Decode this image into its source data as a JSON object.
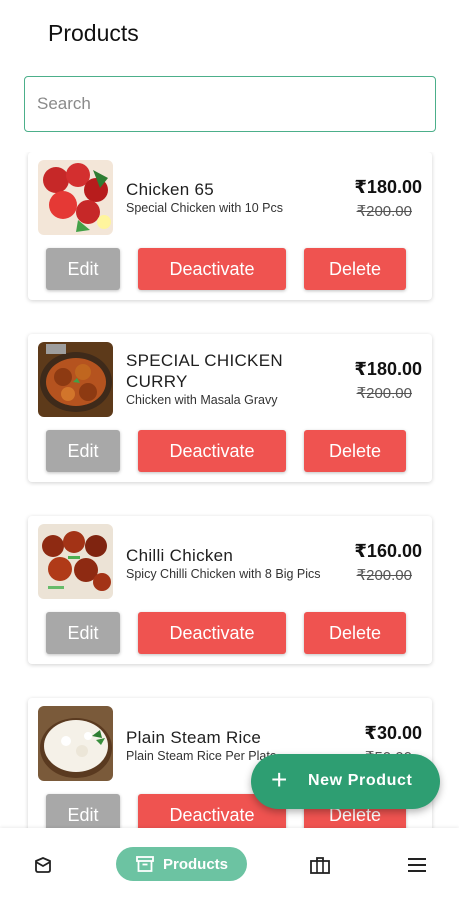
{
  "header": {
    "title": "Products"
  },
  "search": {
    "placeholder": "Search",
    "value": ""
  },
  "products": [
    {
      "name": "Chicken 65",
      "description": "Special Chicken with 10 Pcs",
      "price": "₹180.00",
      "old_price": "₹200.00",
      "image": "chicken-65-photo"
    },
    {
      "name": "SPECIAL CHICKEN CURRY",
      "description": "Chicken with Masala Gravy",
      "price": "₹180.00",
      "old_price": "₹200.00",
      "image": "chicken-curry-photo"
    },
    {
      "name": "Chilli Chicken",
      "description": "Spicy Chilli Chicken with 8 Big Pics",
      "price": "₹160.00",
      "old_price": "₹200.00",
      "image": "chilli-chicken-photo"
    },
    {
      "name": "Plain Steam Rice",
      "description": "Plain Steam Rice Per Plate",
      "price": "₹30.00",
      "old_price": "₹50.00",
      "image": "steam-rice-photo"
    }
  ],
  "buttons": {
    "edit": "Edit",
    "deactivate": "Deactivate",
    "delete": "Delete"
  },
  "fab": {
    "label": "New Product",
    "icon": "plus-icon"
  },
  "bottom_nav": {
    "items": [
      {
        "icon": "orders-box-icon"
      },
      {
        "icon": "archive-icon",
        "label": "Products",
        "active": true
      },
      {
        "icon": "briefcase-icon"
      },
      {
        "icon": "menu-icon"
      }
    ]
  },
  "colors": {
    "accent": "#2e9e72",
    "active_pill": "#6cc3a2",
    "danger": "#ef5350",
    "edit": "#a8a8a8",
    "search_border": "#4caf8a"
  }
}
